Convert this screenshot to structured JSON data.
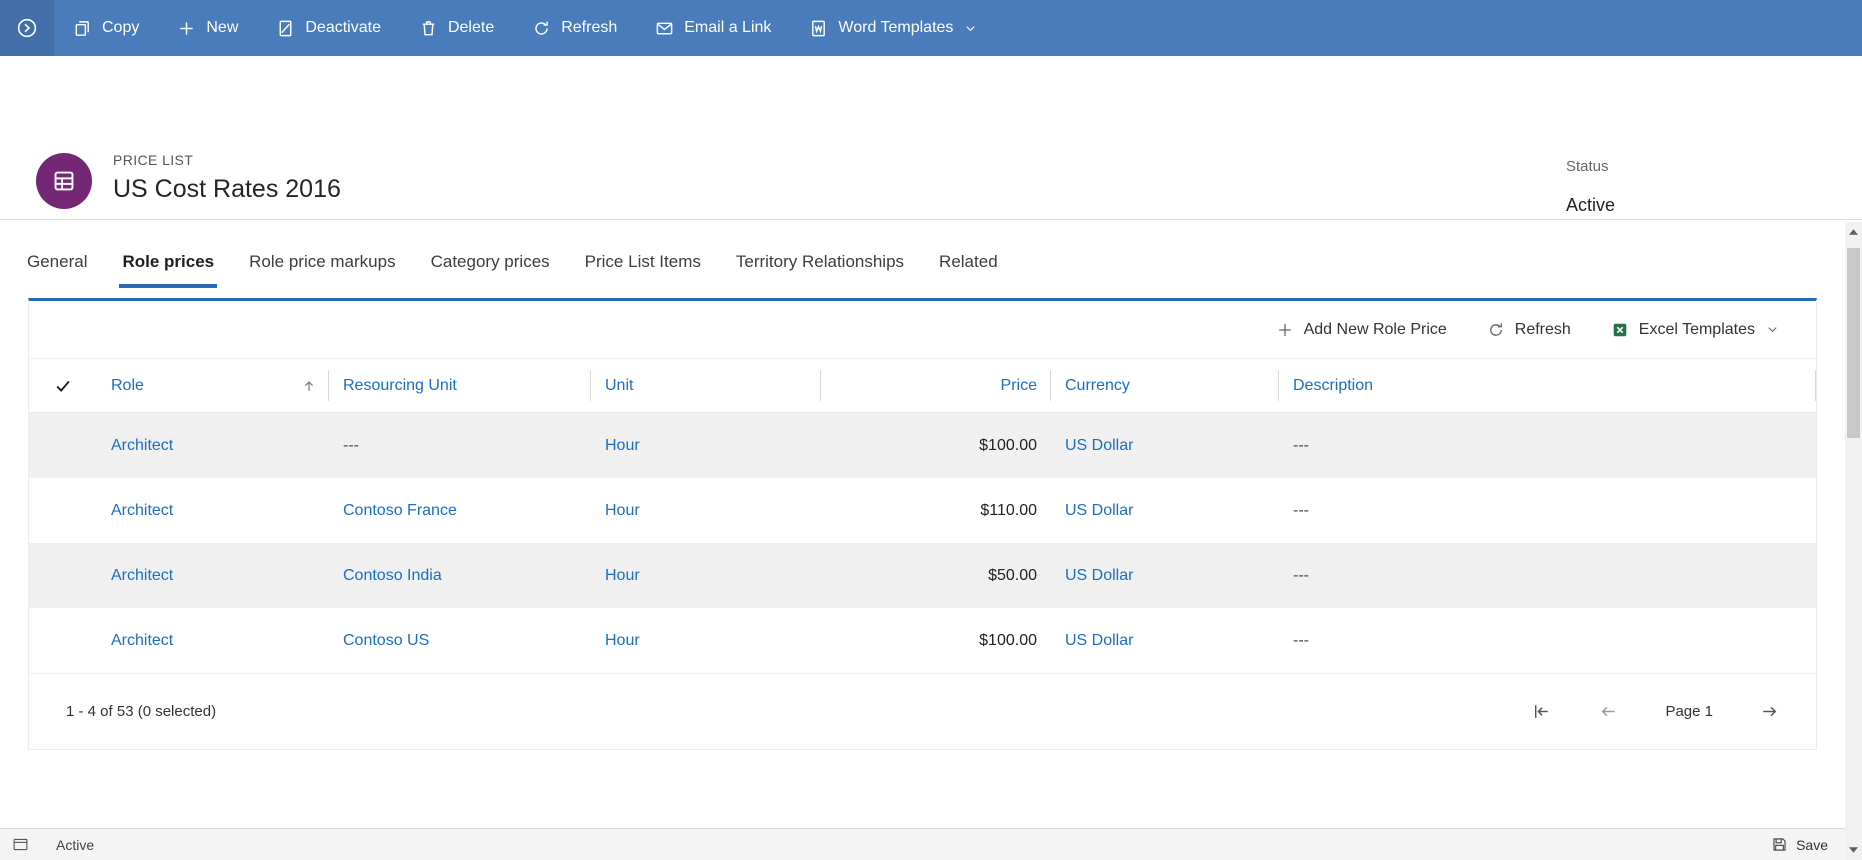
{
  "colors": {
    "command_bar_blue": "#4a7cbc",
    "accent_blue": "#2a6cb4",
    "link_blue": "#1b6ec2",
    "entity_purple": "#742774",
    "excel_green": "#217346"
  },
  "command_bar": {
    "items": [
      {
        "label": "Copy"
      },
      {
        "label": "New"
      },
      {
        "label": "Deactivate"
      },
      {
        "label": "Delete"
      },
      {
        "label": "Refresh"
      },
      {
        "label": "Email a Link"
      },
      {
        "label": "Word Templates"
      }
    ]
  },
  "header": {
    "entity_label": "PRICE LIST",
    "title": "US Cost Rates 2016",
    "status_label": "Status",
    "status_value": "Active"
  },
  "tabs": [
    {
      "label": "General"
    },
    {
      "label": "Role prices"
    },
    {
      "label": "Role price markups"
    },
    {
      "label": "Category prices"
    },
    {
      "label": "Price List Items"
    },
    {
      "label": "Territory Relationships"
    },
    {
      "label": "Related"
    }
  ],
  "grid": {
    "toolbar": {
      "add_new_label": "Add New Role Price",
      "refresh_label": "Refresh",
      "excel_label": "Excel Templates"
    },
    "columns": {
      "role": "Role",
      "resourcing_unit": "Resourcing Unit",
      "unit": "Unit",
      "price": "Price",
      "currency": "Currency",
      "description": "Description"
    },
    "rows": [
      {
        "role": "Architect",
        "resourcing_unit": "---",
        "unit": "Hour",
        "price": "$100.00",
        "currency": "US Dollar",
        "description": "---"
      },
      {
        "role": "Architect",
        "resourcing_unit": "Contoso France",
        "unit": "Hour",
        "price": "$110.00",
        "currency": "US Dollar",
        "description": "---"
      },
      {
        "role": "Architect",
        "resourcing_unit": "Contoso India",
        "unit": "Hour",
        "price": "$50.00",
        "currency": "US Dollar",
        "description": "---"
      },
      {
        "role": "Architect",
        "resourcing_unit": "Contoso US",
        "unit": "Hour",
        "price": "$100.00",
        "currency": "US Dollar",
        "description": "---"
      }
    ],
    "footer": {
      "record_count": "1 - 4 of 53 (0 selected)",
      "page_label": "Page 1"
    }
  },
  "status_bar": {
    "state": "Active",
    "save_label": "Save"
  }
}
